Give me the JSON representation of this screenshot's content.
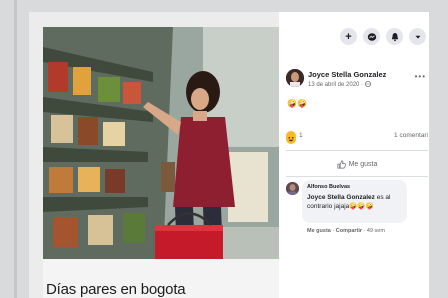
{
  "post": {
    "title": "Días pares en bogota"
  },
  "header_actions": {
    "plus": "+",
    "icons": [
      "plus-icon",
      "messenger-icon",
      "bell-icon",
      "chevron-down-icon"
    ]
  },
  "author": {
    "name": "Joyce Stella Gonzalez",
    "date": "13 de abril de 2020 · ",
    "more": "•••",
    "emojis": "🤪🤪"
  },
  "reactions": {
    "count": "1",
    "comments": "1 comentari"
  },
  "actions": {
    "like": "Me gusta"
  },
  "comment": {
    "author": "Alfonso Buelvas",
    "mention": "Joyce Stella Gonzalez",
    "text": " es al contrario jajaja🤪🤪🤪",
    "like": "Me gusta",
    "reply": "Compartir",
    "time": "49 sem",
    "separator": " · "
  },
  "colors": {
    "accent": "#1877f2",
    "panel_bg": "#ffffff",
    "page_bg": "#d9dadb"
  }
}
